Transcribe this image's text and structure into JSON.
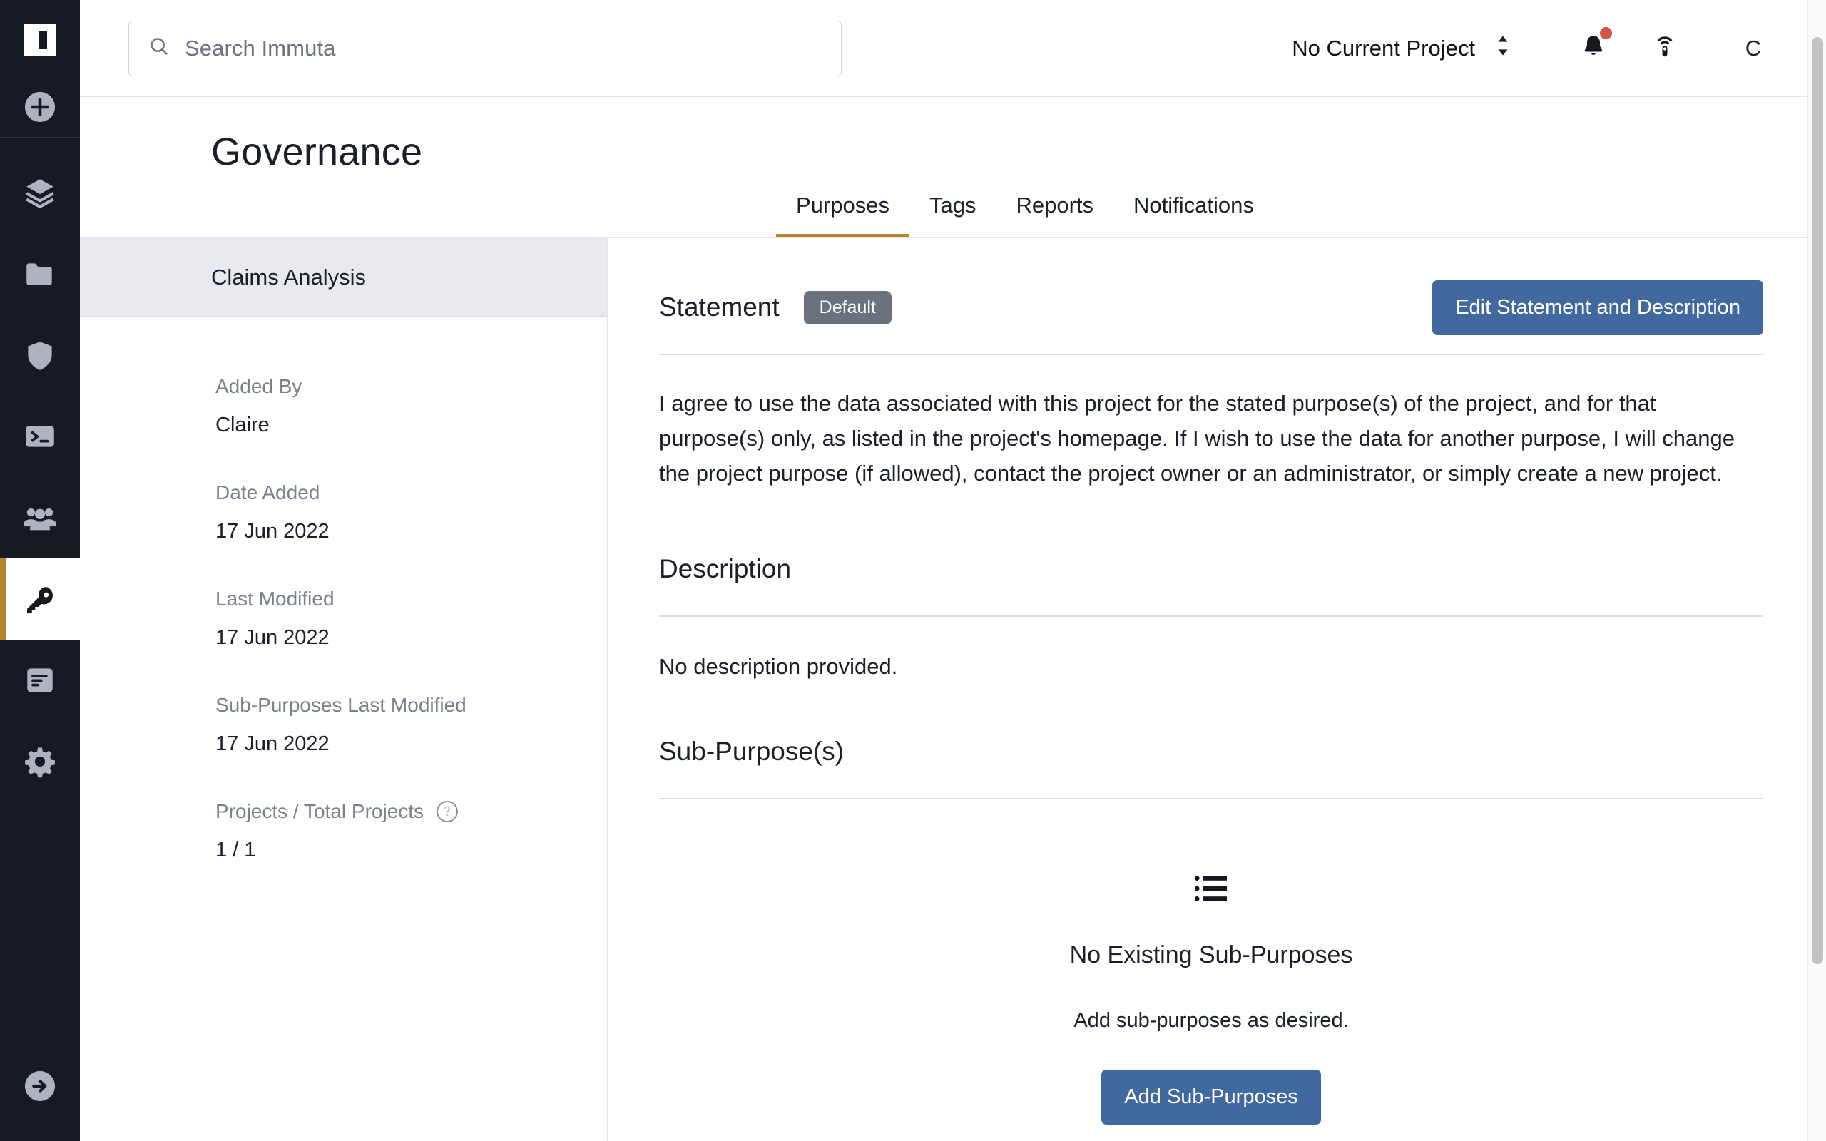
{
  "rail": {
    "logo_name": "immuta-logo",
    "items": [
      {
        "name": "add",
        "icon": "plus-circle-icon"
      },
      {
        "name": "data-sources",
        "icon": "layers-icon"
      },
      {
        "name": "projects",
        "icon": "folder-icon"
      },
      {
        "name": "policies",
        "icon": "shield-icon"
      },
      {
        "name": "query-engine",
        "icon": "terminal-icon"
      },
      {
        "name": "people",
        "icon": "users-icon"
      },
      {
        "name": "governance",
        "icon": "key-icon",
        "active": true
      },
      {
        "name": "audit",
        "icon": "document-icon"
      },
      {
        "name": "settings",
        "icon": "gear-icon"
      }
    ],
    "bottom_item": {
      "name": "sign-out",
      "icon": "arrow-right-circle-icon"
    }
  },
  "topbar": {
    "search": {
      "placeholder": "Search Immuta",
      "value": "",
      "icon": "search-icon"
    },
    "project_selector": {
      "label": "No Current Project",
      "icon": "chevron-updown-icon"
    },
    "notifications": {
      "icon": "bell-icon",
      "has_unread": true
    },
    "broadcast": {
      "icon": "beacon-icon"
    },
    "avatar": {
      "initial": "C"
    }
  },
  "page": {
    "title": "Governance",
    "tabs": [
      {
        "label": "Purposes",
        "active": true
      },
      {
        "label": "Tags",
        "active": false
      },
      {
        "label": "Reports",
        "active": false
      },
      {
        "label": "Notifications",
        "active": false
      }
    ]
  },
  "detail_panel": {
    "header_title": "Claims Analysis",
    "fields": [
      {
        "label": "Added By",
        "value": "Claire"
      },
      {
        "label": "Date Added",
        "value": "17 Jun 2022"
      },
      {
        "label": "Last Modified",
        "value": "17 Jun 2022"
      },
      {
        "label": "Sub-Purposes Last Modified",
        "value": "17 Jun 2022"
      },
      {
        "label": "Projects / Total Projects",
        "value": "1 / 1",
        "help": "?"
      }
    ]
  },
  "content": {
    "statement": {
      "title": "Statement",
      "badge": "Default",
      "edit_button": "Edit Statement and Description",
      "text": "I agree to use the data associated with this project for the stated purpose(s) of the project, and for that purpose(s) only, as listed in the project's homepage. If I wish to use the data for another purpose, I will change the project purpose (if allowed), contact the project owner or an administrator, or simply create a new project."
    },
    "description": {
      "title": "Description",
      "text": "No description provided."
    },
    "sub_purposes": {
      "title": "Sub-Purpose(s)",
      "empty_icon": "list-icon",
      "empty_title": "No Existing Sub-Purposes",
      "empty_subtitle": "Add sub-purposes as desired.",
      "add_button": "Add Sub-Purposes"
    }
  },
  "colors": {
    "accent_gold": "#b5862f",
    "primary_blue": "#41699f",
    "badge_gray": "#6c717e",
    "rail_dark": "#161a23",
    "notification_red": "#d4544a"
  }
}
